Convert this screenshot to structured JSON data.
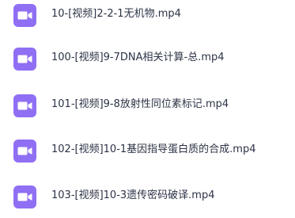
{
  "file_list": {
    "icon_color": "#8f6ff3",
    "files": [
      {
        "name": "10-[视频]2-2-1无机物.mp4",
        "icon": "video-file-icon"
      },
      {
        "name": "100-[视频]9-7DNA相关计算-总.mp4",
        "icon": "video-file-icon"
      },
      {
        "name": "101-[视频]9-8放射性同位素标记.mp4",
        "icon": "video-file-icon"
      },
      {
        "name": "102-[视频]10-1基因指导蛋白质的合成.mp4",
        "icon": "video-file-icon"
      },
      {
        "name": "103-[视频]10-3遗传密码破译.mp4",
        "icon": "video-file-icon"
      }
    ]
  }
}
